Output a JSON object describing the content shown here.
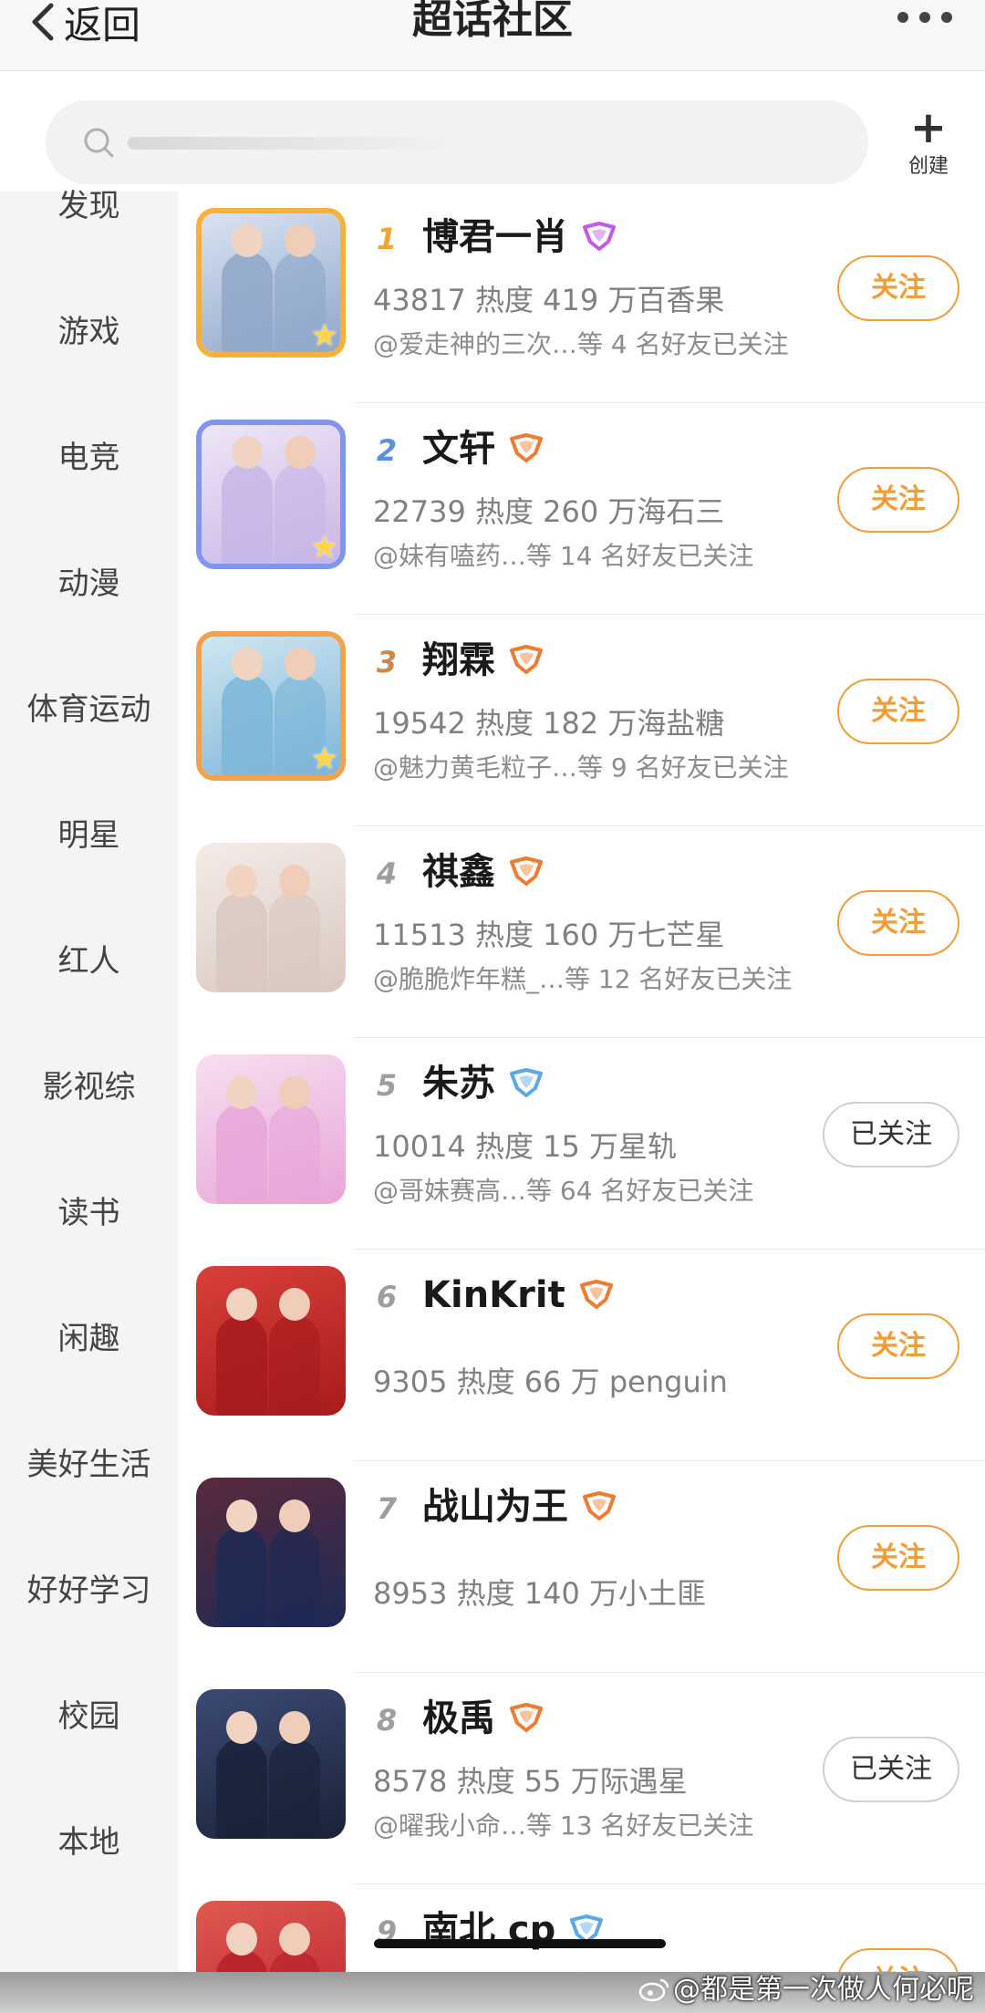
{
  "header": {
    "back_label": "返回",
    "title": "超话社区"
  },
  "search": {
    "placeholder": ""
  },
  "create": {
    "label": "创建"
  },
  "categories": [
    "发现",
    "游戏",
    "电竞",
    "动漫",
    "体育运动",
    "明星",
    "红人",
    "影视综",
    "读书",
    "闲趣",
    "美好生活",
    "好好学习",
    "校园",
    "本地"
  ],
  "communities": [
    {
      "rank": "1",
      "name": "博君一肖",
      "stats": "43817 热度 419 万百香果",
      "friends": "@爱走神的三次…等 4 名好友已关注",
      "button": "关注",
      "followed": false,
      "badge_color": "#c658e8",
      "rank_color": "#f2a432",
      "frame_color": "#f7b13a",
      "thumb_bg": [
        "#8fa7c9",
        "#d9e3f2"
      ]
    },
    {
      "rank": "2",
      "name": "文轩",
      "stats": "22739 热度 260 万海石三",
      "friends": "@妹有嗑药…等 14 名好友已关注",
      "button": "关注",
      "followed": false,
      "badge_color": "#f07b2f",
      "rank_color": "#5b8fe0",
      "frame_color": "#7f95f0",
      "thumb_bg": [
        "#c7b6e6",
        "#efe6f7"
      ]
    },
    {
      "rank": "3",
      "name": "翔霖",
      "stats": "19542 热度 182 万海盐糖",
      "friends": "@魅力黄毛粒子…等 9 名好友已关注",
      "button": "关注",
      "followed": false,
      "badge_color": "#f07b2f",
      "rank_color": "#c98a4c",
      "frame_color": "#f2a24c",
      "thumb_bg": [
        "#7db6d8",
        "#cfe6f2"
      ]
    },
    {
      "rank": "4",
      "name": "祺鑫",
      "stats": "11513 热度 160 万七芒星",
      "friends": "@脆脆炸年糕_…等 12 名好友已关注",
      "button": "关注",
      "followed": false,
      "badge_color": "#f07b2f",
      "rank_color": "#9e9e9e",
      "frame_color": "",
      "thumb_bg": [
        "#d9c8c0",
        "#f4ece8"
      ]
    },
    {
      "rank": "5",
      "name": "朱苏",
      "stats": "10014 热度 15 万星轨",
      "friends": "@哥妹赛高…等 64 名好友已关注",
      "button": "已关注",
      "followed": true,
      "badge_color": "#5aa8e8",
      "rank_color": "#9e9e9e",
      "frame_color": "",
      "thumb_bg": [
        "#e8a6d8",
        "#f7dff0"
      ]
    },
    {
      "rank": "6",
      "name": "KinKrit",
      "stats": "9305 热度 66 万 penguin",
      "friends": "",
      "button": "关注",
      "followed": false,
      "badge_color": "#f07b2f",
      "rank_color": "#9e9e9e",
      "frame_color": "",
      "thumb_bg": [
        "#a81b1b",
        "#d9403a"
      ]
    },
    {
      "rank": "7",
      "name": "战山为王",
      "stats": "8953 热度 140 万小土匪",
      "friends": "",
      "button": "关注",
      "followed": false,
      "badge_color": "#f07b2f",
      "rank_color": "#9e9e9e",
      "frame_color": "",
      "thumb_bg": [
        "#1d2a55",
        "#5a2a3c"
      ]
    },
    {
      "rank": "8",
      "name": "极禹",
      "stats": "8578 热度 55 万际遇星",
      "friends": "@曜我小命…等 13 名好友已关注",
      "button": "已关注",
      "followed": true,
      "badge_color": "#f07b2f",
      "rank_color": "#9e9e9e",
      "frame_color": "",
      "thumb_bg": [
        "#1a2238",
        "#3c4a74"
      ]
    },
    {
      "rank": "9",
      "name": "南北 cp",
      "stats": "",
      "friends": "",
      "button": "关注",
      "followed": false,
      "badge_color": "#5aa8e8",
      "rank_color": "#9e9e9e",
      "frame_color": "",
      "thumb_bg": [
        "#b81e2a",
        "#e05a50"
      ]
    }
  ],
  "watermark": "@都是第一次做人何必呢"
}
